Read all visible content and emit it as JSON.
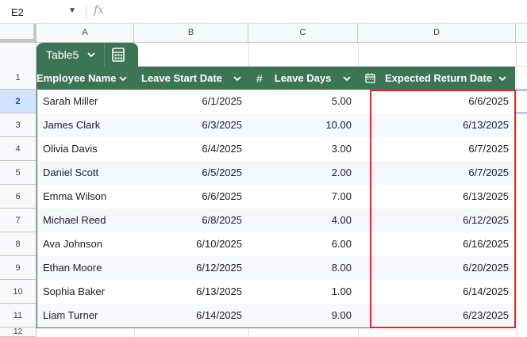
{
  "formula_bar": {
    "cell_ref": "E2",
    "fx_label": "fx"
  },
  "columns": [
    "A",
    "B",
    "C",
    "D"
  ],
  "rows": [
    "1",
    "2",
    "3",
    "4",
    "5",
    "6",
    "7",
    "8",
    "9",
    "10",
    "11",
    "12"
  ],
  "table": {
    "name": "Table5",
    "headers": {
      "employee_name": "Employee Name",
      "leave_start_date": "Leave Start Date",
      "leave_days": "Leave Days",
      "expected_return_date": "Expected Return Date"
    },
    "data": [
      {
        "name": "Sarah Miller",
        "start": "6/1/2025",
        "days": "5.00",
        "return": "6/6/2025"
      },
      {
        "name": "James Clark",
        "start": "6/3/2025",
        "days": "10.00",
        "return": "6/13/2025"
      },
      {
        "name": "Olivia Davis",
        "start": "6/4/2025",
        "days": "3.00",
        "return": "6/7/2025"
      },
      {
        "name": "Daniel Scott",
        "start": "6/5/2025",
        "days": "2.00",
        "return": "6/7/2025"
      },
      {
        "name": "Emma Wilson",
        "start": "6/6/2025",
        "days": "7.00",
        "return": "6/13/2025"
      },
      {
        "name": "Michael Reed",
        "start": "6/8/2025",
        "days": "4.00",
        "return": "6/12/2025"
      },
      {
        "name": "Ava Johnson",
        "start": "6/10/2025",
        "days": "6.00",
        "return": "6/16/2025"
      },
      {
        "name": "Ethan Moore",
        "start": "6/12/2025",
        "days": "8.00",
        "return": "6/20/2025"
      },
      {
        "name": "Sophia Baker",
        "start": "6/13/2025",
        "days": "1.00",
        "return": "6/14/2025"
      },
      {
        "name": "Liam Turner",
        "start": "6/14/2025",
        "days": "9.00",
        "return": "6/23/2025"
      }
    ]
  },
  "colors": {
    "table_header": "#3d7456",
    "highlight_box": "#d93025",
    "active_row_header": "#d3e3fd",
    "banded_row": "#f6f8f9"
  },
  "icons": {
    "name_box_dropdown": "caret-down-icon",
    "table_menu": "chevron-down-icon",
    "table_grid": "table-calculator-icon",
    "number_type": "hash-icon",
    "date_type": "calendar-icon"
  }
}
